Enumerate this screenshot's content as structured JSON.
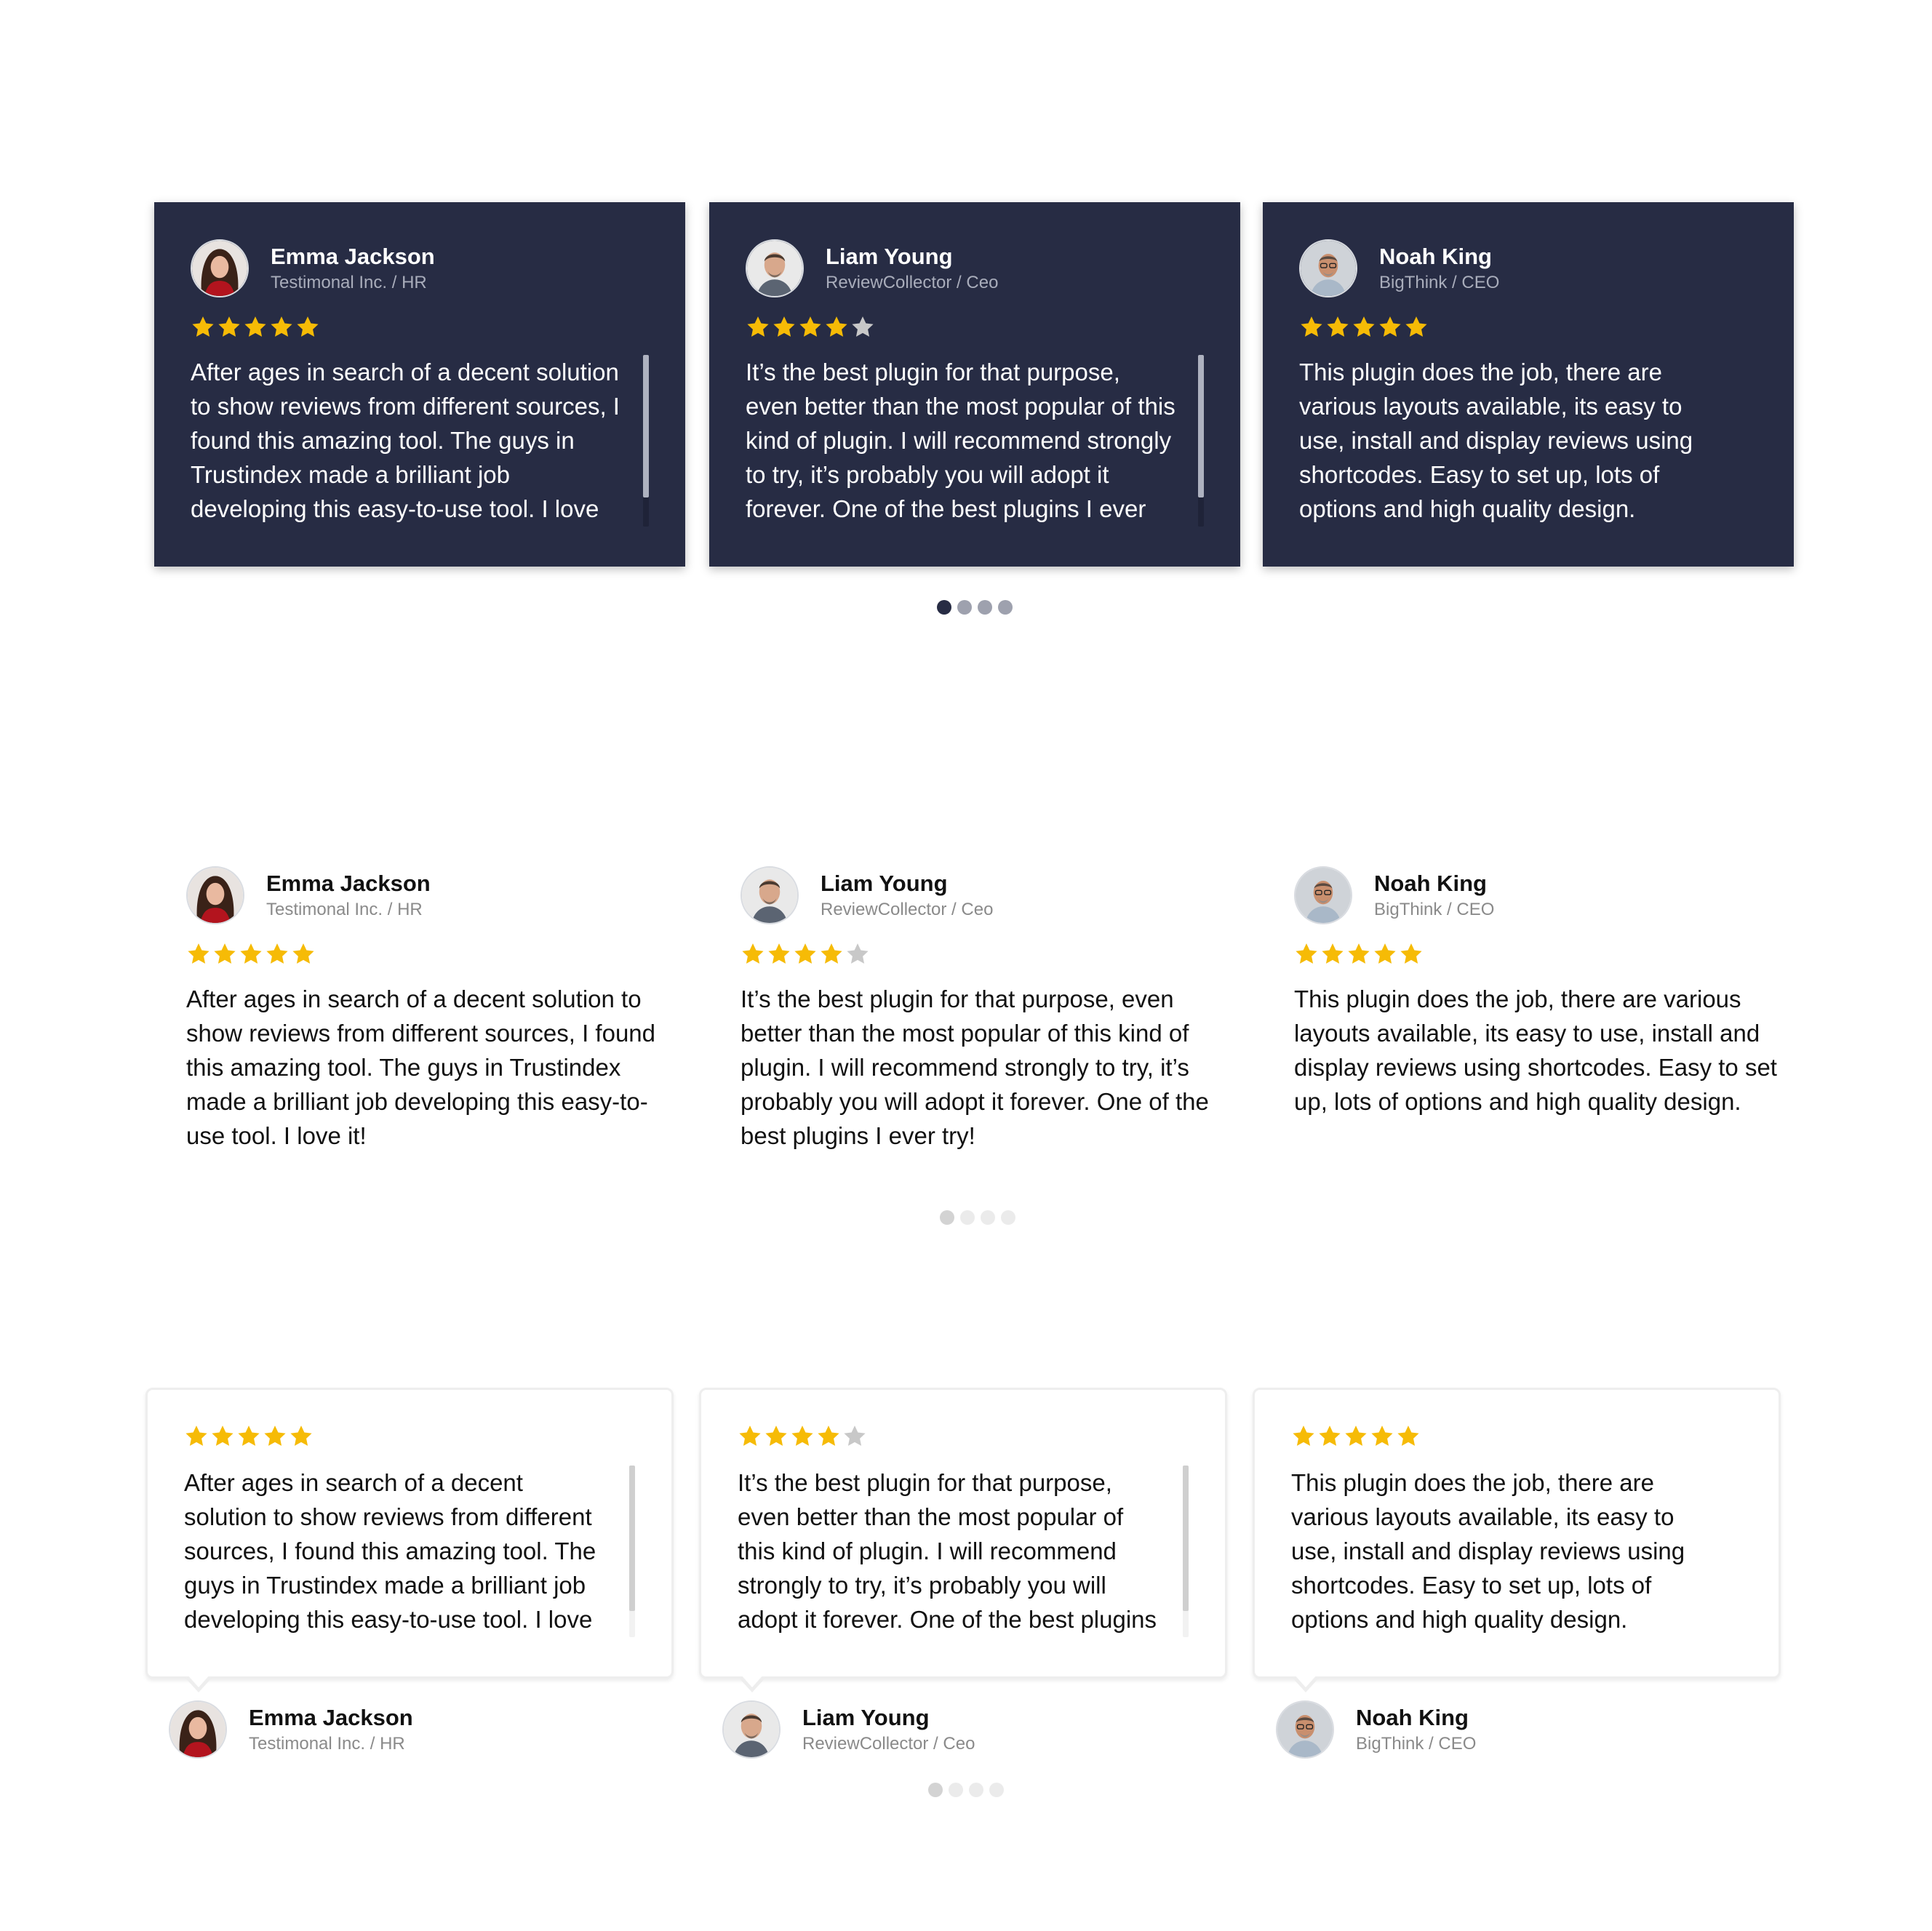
{
  "reviews": [
    {
      "name": "Emma Jackson",
      "company": "Testimonal Inc. / HR",
      "rating": 5,
      "avatar_icon": "female-portrait",
      "text": "After ages in search of a decent solution to show reviews from different sources, I found this amazing tool. The guys in Trustindex made a brilliant job developing this easy-to-use tool. I love it!"
    },
    {
      "name": "Liam Young",
      "company": "ReviewCollector / Ceo",
      "rating": 4,
      "avatar_icon": "male-portrait",
      "text": "It’s the best plugin for that purpose, even better than the most popular of this kind of plugin. I will recommend strongly to try, it’s probably you will adopt it forever. One of the best plugins I ever try!"
    },
    {
      "name": "Noah King",
      "company": "BigThink / CEO",
      "rating": 5,
      "avatar_icon": "male-glasses-portrait",
      "text": "This plugin does the job, there are various layouts available, its easy to use, install and display reviews using shortcodes. Easy to set up, lots of options and high quality design."
    }
  ],
  "pagination": {
    "pages": 4,
    "active": 1
  },
  "colors": {
    "star_filled": "#f6bb06",
    "star_empty": "#c8c8c8",
    "dark_card_bg": "#272c44",
    "dot_active_dark": "#272c44",
    "dot_inactive_dark": "#9ea1ae",
    "dot_active_light": "#d3d3d3",
    "dot_inactive_light": "#ebebeb"
  }
}
